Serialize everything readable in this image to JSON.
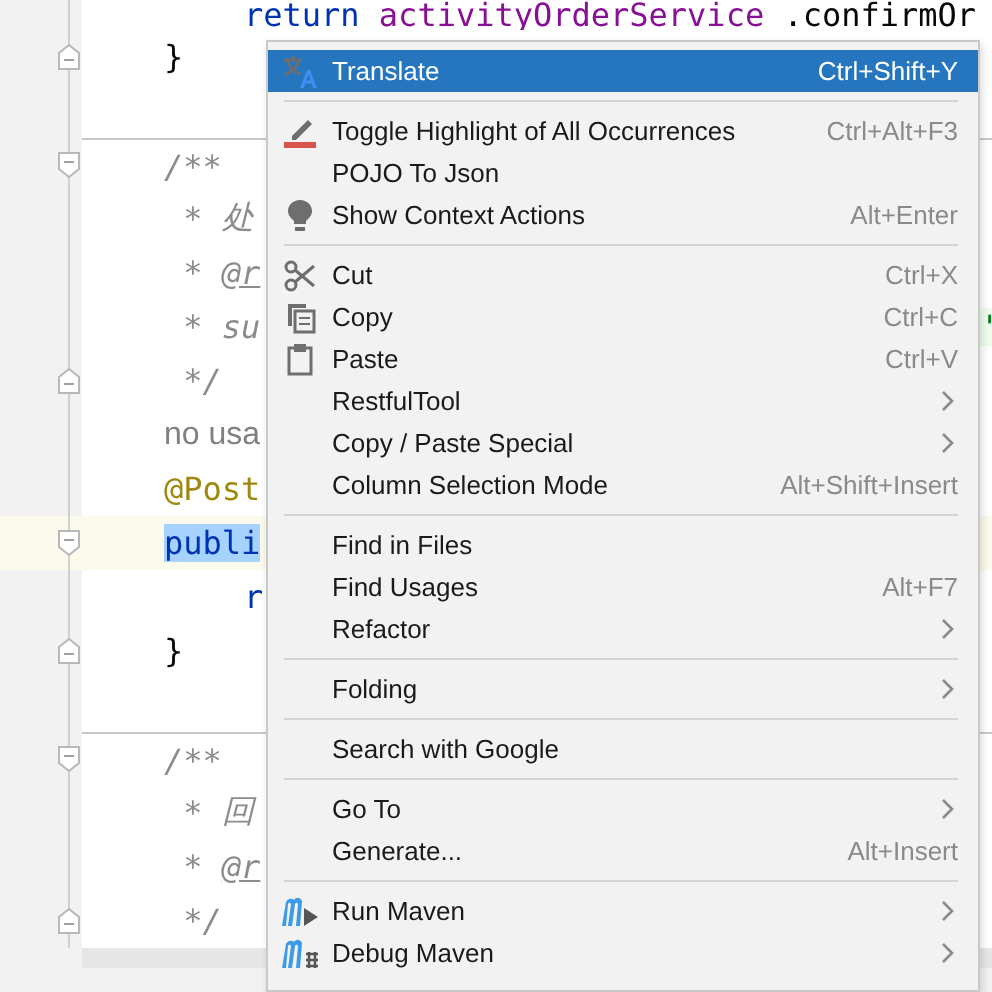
{
  "editor": {
    "lines": [
      {
        "kind": "body",
        "segments": [
          {
            "text": "return",
            "kind": "keyword"
          },
          {
            "text": "activityOrderService",
            "kind": "field"
          },
          {
            "text": ".confirmOr",
            "kind": "plain"
          }
        ]
      },
      {
        "kind": "member",
        "segments": [
          {
            "text": "}",
            "kind": "plain"
          }
        ]
      },
      {
        "kind": "blank"
      },
      {
        "kind": "member",
        "separator": true,
        "segments": [
          {
            "text": "/**",
            "kind": "comment"
          }
        ]
      },
      {
        "kind": "member",
        "segments": [
          {
            "text": "*",
            "kind": "doc-star"
          },
          {
            "text": "处",
            "kind": "comment"
          }
        ]
      },
      {
        "kind": "member",
        "segments": [
          {
            "text": "*",
            "kind": "doc-star"
          },
          {
            "text": "@r",
            "kind": "doc-tag"
          }
        ]
      },
      {
        "kind": "member",
        "segments": [
          {
            "text": "*",
            "kind": "doc-star"
          },
          {
            "text": "su",
            "kind": "comment"
          }
        ],
        "tail": {
          "text": "'",
          "kind": "string"
        }
      },
      {
        "kind": "member",
        "segments": [
          {
            "text": "*/",
            "kind": "doc-star"
          }
        ]
      },
      {
        "kind": "member",
        "segments": [
          {
            "text": "no usa",
            "kind": "hint"
          }
        ]
      },
      {
        "kind": "member",
        "segments": [
          {
            "text": "@Post",
            "kind": "annotation"
          }
        ]
      },
      {
        "kind": "member",
        "current": true,
        "segments": [
          {
            "text": "publi",
            "kind": "keyword-selected"
          }
        ]
      },
      {
        "kind": "body",
        "segments": [
          {
            "text": "r",
            "kind": "keyword"
          }
        ]
      },
      {
        "kind": "member",
        "segments": [
          {
            "text": "}",
            "kind": "plain"
          }
        ]
      },
      {
        "kind": "blank"
      },
      {
        "kind": "member",
        "separator": true,
        "segments": [
          {
            "text": "/**",
            "kind": "comment"
          }
        ]
      },
      {
        "kind": "member",
        "segments": [
          {
            "text": "*",
            "kind": "doc-star"
          },
          {
            "text": "回",
            "kind": "comment"
          }
        ]
      },
      {
        "kind": "member",
        "segments": [
          {
            "text": "*",
            "kind": "doc-star"
          },
          {
            "text": "@r",
            "kind": "doc-tag"
          }
        ]
      },
      {
        "kind": "member",
        "segments": [
          {
            "text": "*/",
            "kind": "doc-star"
          }
        ]
      }
    ]
  },
  "menu": {
    "items": [
      {
        "kind": "item",
        "label": "Translate",
        "shortcut": "Ctrl+Shift+Y",
        "submenu": false,
        "selected": true
      },
      {
        "kind": "separator"
      },
      {
        "kind": "item",
        "label": "Toggle Highlight of All Occurrences",
        "shortcut": "Ctrl+Alt+F3",
        "submenu": false,
        "selected": false
      },
      {
        "kind": "item",
        "label": "POJO To Json",
        "submenu": false,
        "selected": false
      },
      {
        "kind": "item",
        "label": "Show Context Actions",
        "shortcut": "Alt+Enter",
        "submenu": false,
        "selected": false
      },
      {
        "kind": "separator"
      },
      {
        "kind": "item",
        "label": "Cut",
        "shortcut": "Ctrl+X",
        "submenu": false,
        "selected": false
      },
      {
        "kind": "item",
        "label": "Copy",
        "shortcut": "Ctrl+C",
        "submenu": false,
        "selected": false
      },
      {
        "kind": "item",
        "label": "Paste",
        "shortcut": "Ctrl+V",
        "submenu": false,
        "selected": false
      },
      {
        "kind": "item",
        "label": "RestfulTool",
        "submenu": true,
        "selected": false
      },
      {
        "kind": "item",
        "label": "Copy / Paste Special",
        "submenu": true,
        "selected": false
      },
      {
        "kind": "item",
        "label": "Column Selection Mode",
        "shortcut": "Alt+Shift+Insert",
        "submenu": false,
        "selected": false
      },
      {
        "kind": "separator"
      },
      {
        "kind": "item",
        "label": "Find in Files",
        "submenu": false,
        "selected": false
      },
      {
        "kind": "item",
        "label": "Find Usages",
        "shortcut": "Alt+F7",
        "submenu": false,
        "selected": false
      },
      {
        "kind": "item",
        "label": "Refactor",
        "submenu": true,
        "selected": false
      },
      {
        "kind": "separator"
      },
      {
        "kind": "item",
        "label": "Folding",
        "submenu": true,
        "selected": false
      },
      {
        "kind": "separator"
      },
      {
        "kind": "item",
        "label": "Search with Google",
        "submenu": false,
        "selected": false
      },
      {
        "kind": "separator"
      },
      {
        "kind": "item",
        "label": "Go To",
        "submenu": true,
        "selected": false
      },
      {
        "kind": "item",
        "label": "Generate...",
        "shortcut": "Alt+Insert",
        "submenu": false,
        "selected": false
      },
      {
        "kind": "separator"
      },
      {
        "kind": "item",
        "label": "Run Maven",
        "submenu": true,
        "selected": false
      },
      {
        "kind": "item",
        "label": "Debug Maven",
        "submenu": true,
        "selected": false
      }
    ]
  }
}
